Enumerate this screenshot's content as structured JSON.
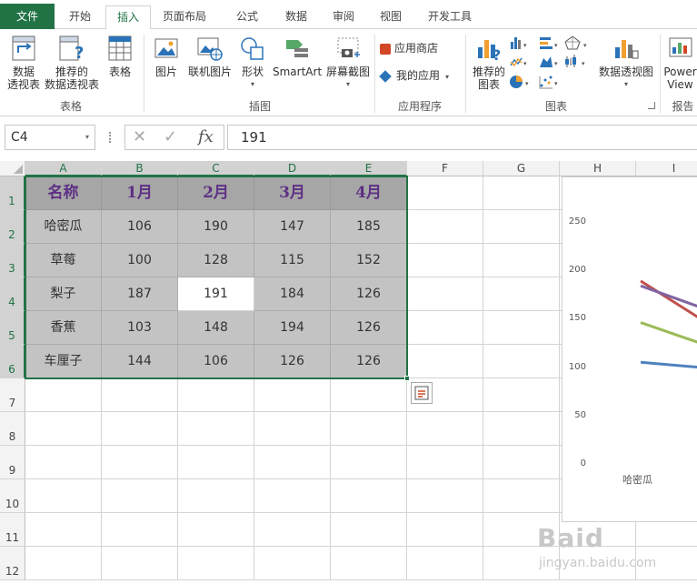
{
  "tabs": {
    "file": "文件",
    "items": [
      "开始",
      "插入",
      "页面布局",
      "公式",
      "数据",
      "审阅",
      "视图",
      "开发工具"
    ],
    "active_index": 1
  },
  "ribbon": {
    "groups": {
      "tables": "表格",
      "illustrations": "插图",
      "apps": "应用程序",
      "charts": "图表",
      "reports": "报告"
    },
    "buttons": {
      "pivot_line1": "数据",
      "pivot_line2": "透视表",
      "rec_pivot_line1": "推荐的",
      "rec_pivot_line2": "数据透视表",
      "table": "表格",
      "picture": "图片",
      "online_picture": "联机图片",
      "shapes": "形状",
      "smartart": "SmartArt",
      "screenshot": "屏幕截图",
      "app_store": "应用商店",
      "my_apps": "我的应用",
      "rec_chart_line1": "推荐的",
      "rec_chart_line2": "图表",
      "pivot_chart": "数据透视图",
      "power_line1": "Power",
      "power_line2": "View"
    }
  },
  "formula_bar": {
    "name_box": "C4",
    "cancel_glyph": "✕",
    "enter_glyph": "✓",
    "fx_glyph": "fx",
    "value": "191"
  },
  "columns": [
    "A",
    "B",
    "C",
    "D",
    "E",
    "F",
    "G",
    "H",
    "I"
  ],
  "rows": [
    "1",
    "2",
    "3",
    "4",
    "5",
    "6",
    "7",
    "8",
    "9",
    "10",
    "11",
    "12"
  ],
  "table": {
    "header": [
      "名称",
      "1月",
      "2月",
      "3月",
      "4月"
    ],
    "rows": [
      [
        "哈密瓜",
        "106",
        "190",
        "147",
        "185"
      ],
      [
        "草莓",
        "100",
        "128",
        "115",
        "152"
      ],
      [
        "梨子",
        "187",
        "191",
        "184",
        "126"
      ],
      [
        "香蕉",
        "103",
        "148",
        "194",
        "126"
      ],
      [
        "车厘子",
        "144",
        "106",
        "126",
        "126"
      ]
    ]
  },
  "active_cell": "C4",
  "chart_data": {
    "type": "line",
    "y_ticks": [
      "250",
      "200",
      "150",
      "100",
      "50",
      "0"
    ],
    "ylim": [
      0,
      250
    ],
    "visible_category": "哈密瓜",
    "series_colors": [
      "#4f81bd",
      "#c0504d",
      "#9bbb59",
      "#8064a2"
    ],
    "series": [
      {
        "values": [
          106,
          100
        ]
      },
      {
        "values": [
          190,
          146
        ]
      },
      {
        "values": [
          147,
          123
        ]
      },
      {
        "values": [
          185,
          160
        ]
      }
    ]
  },
  "watermark": {
    "line1": "Baid",
    "line2": "jingyan.baidu.com"
  }
}
